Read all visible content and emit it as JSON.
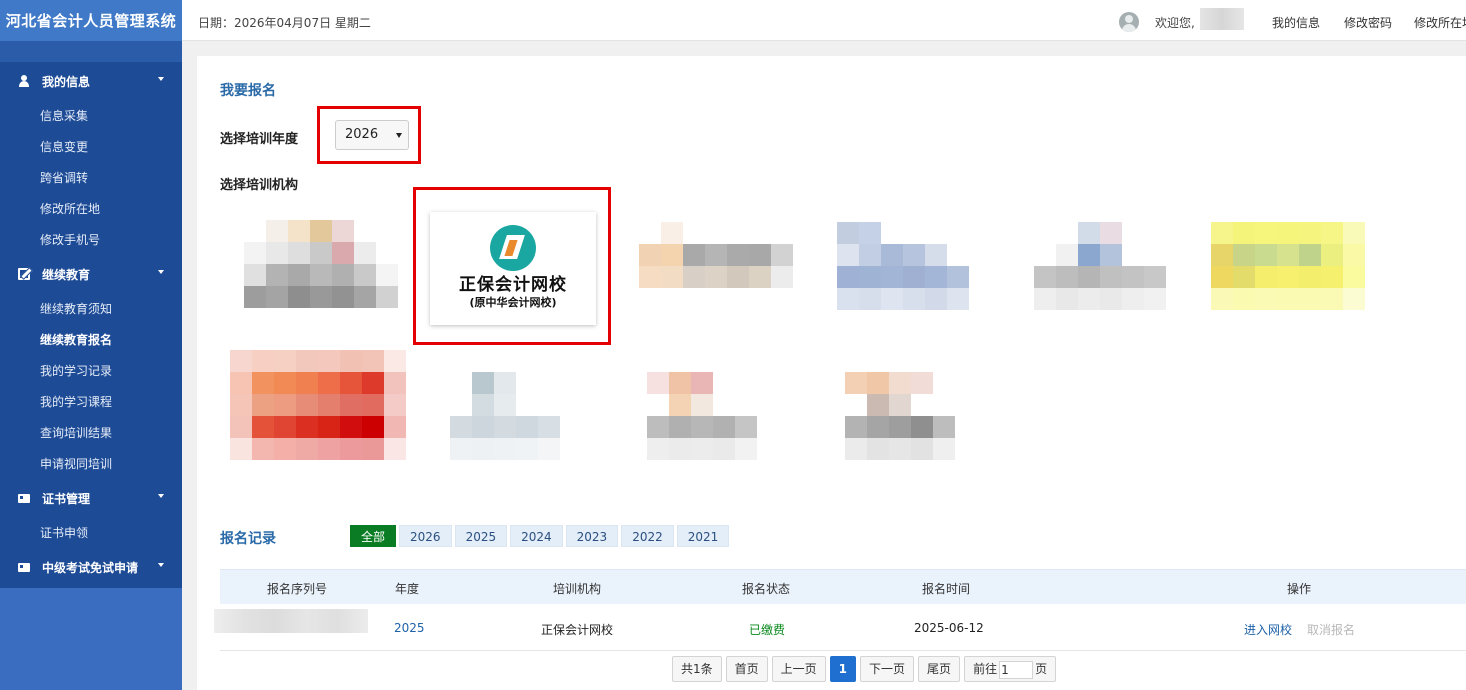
{
  "app": {
    "title": "河北省会计人员管理系统"
  },
  "header": {
    "date": "日期：2026年04月07日 星期二",
    "welcome": "欢迎您,",
    "links": [
      "我的信息",
      "修改密码",
      "修改所在地"
    ]
  },
  "sidebar": {
    "groups": [
      {
        "label": "我的信息",
        "icon": "user-icon",
        "items": [
          "信息采集",
          "信息变更",
          "跨省调转",
          "修改所在地",
          "修改手机号"
        ]
      },
      {
        "label": "继续教育",
        "icon": "edit-icon",
        "items": [
          "继续教育须知",
          "继续教育报名",
          "我的学习记录",
          "我的学习课程",
          "查询培训结果",
          "申请视同培训"
        ]
      },
      {
        "label": "证书管理",
        "icon": "id-card-icon",
        "items": [
          "证书申领"
        ]
      },
      {
        "label": "中级考试免试申请",
        "icon": "id-card-icon",
        "items": []
      }
    ],
    "active_item": "继续教育报名"
  },
  "signup": {
    "title": "我要报名",
    "year_label": "选择培训年度",
    "year_value": "2026",
    "org_label": "选择培训机构",
    "featured_org": {
      "name": "正保会计网校",
      "subtitle": "(原中华会计网校)"
    }
  },
  "records": {
    "title": "报名记录",
    "tabs": [
      "全部",
      "2026",
      "2025",
      "2024",
      "2023",
      "2022",
      "2021"
    ],
    "active_tab": "全部",
    "columns": [
      "报名序列号",
      "年度",
      "培训机构",
      "报名状态",
      "报名时间",
      "操作"
    ],
    "rows": [
      {
        "serial": "",
        "year": "2025",
        "org": "正保会计网校",
        "status": "已缴费",
        "time": "2025-06-12",
        "actions": [
          "进入网校",
          "取消报名"
        ]
      }
    ]
  },
  "pagination": {
    "total": "共1条",
    "first": "首页",
    "prev": "上一页",
    "current": "1",
    "next": "下一页",
    "last": "尾页",
    "goto_prefix": "前往",
    "goto_value": "1",
    "goto_suffix": "页"
  },
  "colors": {
    "sidebar": "#1d4b96",
    "brand": "#3f79c7",
    "accent": "#2a6aa8",
    "highlight": "#e40000",
    "active_tab": "#0a7d24"
  }
}
